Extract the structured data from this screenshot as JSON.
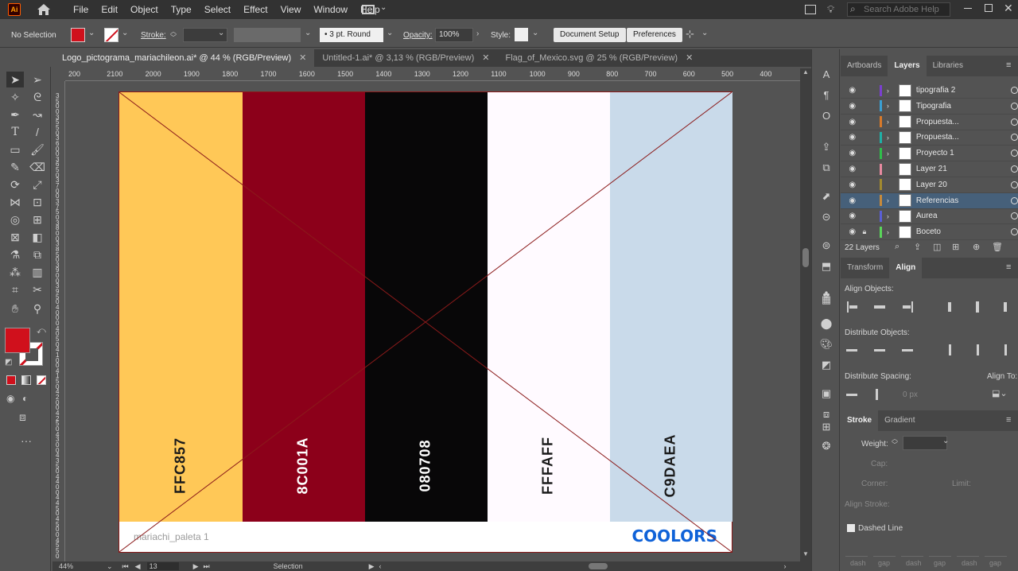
{
  "menubar": {
    "app_logo": "Ai",
    "menus": [
      "File",
      "Edit",
      "Object",
      "Type",
      "Select",
      "Effect",
      "View",
      "Window",
      "Help"
    ],
    "search_placeholder": "Search Adobe Help"
  },
  "controlbar": {
    "selection_status": "No Selection",
    "stroke_label": "Stroke:",
    "brush_value": "3 pt. Round",
    "opacity_label": "Opacity:",
    "opacity_value": "100%",
    "style_label": "Style:",
    "document_setup_label": "Document Setup",
    "preferences_label": "Preferences",
    "fill_color": "#d0101c"
  },
  "tabs": [
    {
      "label": "Logo_pictograma_mariachileon.ai* @ 44 % (RGB/Preview)",
      "active": true
    },
    {
      "label": "Untitled-1.ai* @ 3,13 % (RGB/Preview)",
      "active": false
    },
    {
      "label": "Flag_of_Mexico.svg @ 25 % (RGB/Preview)",
      "active": false
    }
  ],
  "ruler_top": [
    "200",
    "2100",
    "2000",
    "1900",
    "1800",
    "1700",
    "1600",
    "1500",
    "1400",
    "1300",
    "1200",
    "1100",
    "1000",
    "900",
    "800",
    "700",
    "600",
    "500",
    "400"
  ],
  "ruler_left": [
    "3",
    "5",
    "0",
    "0",
    "3",
    "5",
    "5",
    "0",
    "3",
    "6",
    "0",
    "0",
    "3",
    "6",
    "5",
    "0",
    "3",
    "7",
    "0",
    "0",
    "3",
    "7",
    "5",
    "0",
    "3",
    "8",
    "0",
    "0",
    "3",
    "8",
    "5",
    "0",
    "3",
    "9",
    "0",
    "0",
    "3",
    "9",
    "5",
    "0",
    "4",
    "0",
    "0",
    "0",
    "4",
    "0",
    "5",
    "0",
    "4",
    "1",
    "0",
    "0",
    "4",
    "1",
    "5",
    "0",
    "4",
    "2",
    "0",
    "0",
    "4",
    "2",
    "5",
    "0",
    "4",
    "3",
    "0",
    "0",
    "4",
    "3",
    "5",
    "0",
    "4",
    "4",
    "0",
    "0",
    "4",
    "4",
    "5",
    "0",
    "4",
    "5",
    "0",
    "0",
    "4",
    "5",
    "5",
    "0"
  ],
  "artboard": {
    "swatches": [
      {
        "hex": "FFC857",
        "color": "#FFC857",
        "text_color": "#1a1a1a"
      },
      {
        "hex": "8C001A",
        "color": "#8C001A",
        "text_color": "#ffffff"
      },
      {
        "hex": "080708",
        "color": "#080708",
        "text_color": "#ffffff"
      },
      {
        "hex": "FFFAFF",
        "color": "#FFFAFF",
        "text_color": "#1a1a1a"
      },
      {
        "hex": "C9DAEA",
        "color": "#C9DAEA",
        "text_color": "#1a1a1a"
      }
    ],
    "palette_name": "mariachi_paleta 1",
    "brand": "COOLORS",
    "cross_color": "#8b1a1a"
  },
  "status": {
    "zoom": "44%",
    "artboard_number": "13",
    "tool": "Selection"
  },
  "layers_panel": {
    "tabs": [
      "Artboards",
      "Layers",
      "Libraries"
    ],
    "active_tab": "Layers",
    "layers": [
      {
        "name": "tipografia 2",
        "color": "#7b3fd1",
        "has_arrow": true,
        "selected": false,
        "locked": false
      },
      {
        "name": "Tipografia",
        "color": "#3aa0d4",
        "has_arrow": true,
        "selected": false,
        "locked": false
      },
      {
        "name": "Propuesta...",
        "color": "#d97a2a",
        "has_arrow": true,
        "selected": false,
        "locked": false
      },
      {
        "name": "Propuesta...",
        "color": "#1fb0a6",
        "has_arrow": true,
        "selected": false,
        "locked": false
      },
      {
        "name": "Proyecto 1",
        "color": "#2fbf4a",
        "has_arrow": true,
        "selected": false,
        "locked": false
      },
      {
        "name": "Layer 21",
        "color": "#e88aa0",
        "has_arrow": false,
        "selected": false,
        "locked": false
      },
      {
        "name": "Layer 20",
        "color": "#a28a2f",
        "has_arrow": false,
        "selected": false,
        "locked": false
      },
      {
        "name": "Referencias",
        "color": "#c88a3a",
        "has_arrow": true,
        "selected": true,
        "locked": false
      },
      {
        "name": "Aurea",
        "color": "#5a5fd6",
        "has_arrow": true,
        "selected": false,
        "locked": false
      },
      {
        "name": "Boceto",
        "color": "#5ad65a",
        "has_arrow": true,
        "selected": false,
        "locked": true
      }
    ],
    "count_label": "22 Layers"
  },
  "align_panel": {
    "tabs": [
      "Transform",
      "Align"
    ],
    "active_tab": "Align",
    "align_objects_label": "Align Objects:",
    "distribute_objects_label": "Distribute Objects:",
    "distribute_spacing_label": "Distribute Spacing:",
    "align_to_label": "Align To:",
    "spacing_value": "0 px"
  },
  "stroke_panel": {
    "tabs": [
      "Stroke",
      "Gradient"
    ],
    "active_tab": "Stroke",
    "weight_label": "Weight:",
    "cap_label": "Cap:",
    "corner_label": "Corner:",
    "limit_label": "Limit:",
    "align_stroke_label": "Align Stroke:",
    "dashed_line_label": "Dashed Line",
    "dash_labels": [
      "dash",
      "gap",
      "dash",
      "gap",
      "dash",
      "gap"
    ]
  }
}
